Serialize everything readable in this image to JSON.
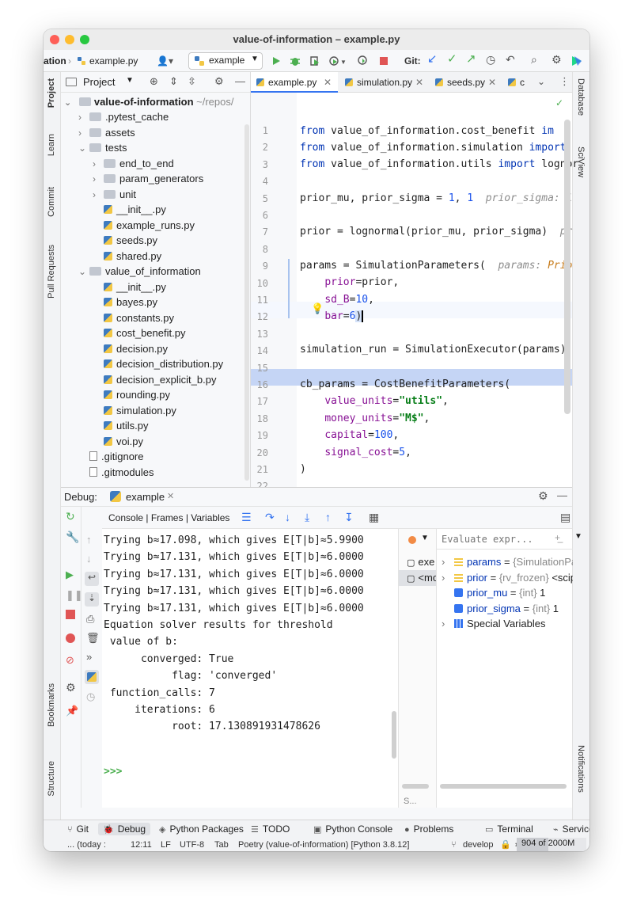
{
  "window": {
    "title": "value-of-information – example.py"
  },
  "toolbar": {
    "breadcrumb_project": "ation",
    "breadcrumb_file": "example.py",
    "run_config": "example",
    "git_label": "Git:"
  },
  "project_panel": {
    "title": "Project",
    "root": {
      "name": "value-of-information",
      "path": "~/repos/"
    },
    "items": [
      {
        "label": ".pytest_cache",
        "type": "folder",
        "arrow": "›"
      },
      {
        "label": "assets",
        "type": "folder",
        "arrow": "›"
      },
      {
        "label": "tests",
        "type": "folder",
        "arrow": "⌄"
      },
      {
        "label": "end_to_end",
        "type": "folder",
        "arrow": "›"
      },
      {
        "label": "param_generators",
        "type": "folder",
        "arrow": "›"
      },
      {
        "label": "unit",
        "type": "folder",
        "arrow": "›"
      },
      {
        "label": "__init__.py",
        "type": "py",
        "arrow": ""
      },
      {
        "label": "example_runs.py",
        "type": "py",
        "arrow": ""
      },
      {
        "label": "seeds.py",
        "type": "py",
        "arrow": ""
      },
      {
        "label": "shared.py",
        "type": "py",
        "arrow": ""
      },
      {
        "label": "value_of_information",
        "type": "folder",
        "arrow": "⌄"
      },
      {
        "label": "__init__.py",
        "type": "py",
        "arrow": ""
      },
      {
        "label": "bayes.py",
        "type": "py",
        "arrow": ""
      },
      {
        "label": "constants.py",
        "type": "py",
        "arrow": ""
      },
      {
        "label": "cost_benefit.py",
        "type": "py",
        "arrow": ""
      },
      {
        "label": "decision.py",
        "type": "py",
        "arrow": ""
      },
      {
        "label": "decision_distribution.py",
        "type": "py",
        "arrow": ""
      },
      {
        "label": "decision_explicit_b.py",
        "type": "py",
        "arrow": ""
      },
      {
        "label": "rounding.py",
        "type": "py",
        "arrow": ""
      },
      {
        "label": "simulation.py",
        "type": "py",
        "arrow": ""
      },
      {
        "label": "utils.py",
        "type": "py",
        "arrow": ""
      },
      {
        "label": "voi.py",
        "type": "py",
        "arrow": ""
      },
      {
        "label": ".gitignore",
        "type": "file",
        "arrow": ""
      },
      {
        "label": ".gitmodules",
        "type": "file",
        "arrow": ""
      }
    ]
  },
  "left_strip": {
    "project": "Project",
    "learn": "Learn",
    "commit": "Commit",
    "pull_requests": "Pull Requests",
    "bookmarks": "Bookmarks",
    "structure": "Structure"
  },
  "right_strip": {
    "database": "Database",
    "sciview": "SciView",
    "notifications": "Notifications"
  },
  "editor": {
    "tabs": [
      {
        "label": "example.py",
        "active": true
      },
      {
        "label": "simulation.py",
        "active": false
      },
      {
        "label": "seeds.py",
        "active": false
      },
      {
        "label": "c",
        "active": false
      }
    ],
    "line_numbers": [
      "1",
      "2",
      "3",
      "4",
      "5",
      "6",
      "7",
      "8",
      "9",
      "10",
      "11",
      "12",
      "13",
      "14",
      "15",
      "16",
      "17",
      "18",
      "19",
      "20",
      "21",
      "22"
    ],
    "lines": {
      "l1a": "from",
      "l1b": " value_of_information.cost_benefit ",
      "l1c": "im",
      "l2a": "from",
      "l2b": " value_of_information.simulation ",
      "l2c": "import",
      "l3a": "from",
      "l3b": " value_of_information.utils ",
      "l3c": "import",
      "l3d": " lognor",
      "l5a": "prior_mu, prior_sigma = ",
      "l5b": "1",
      "l5c": ", ",
      "l5d": "1",
      "l5hint": "  prior_sigma: 1",
      "l7a": "prior = lognormal(prior_mu, prior_sigma)",
      "l7hint": "  pr",
      "l9a": "params = SimulationParameters(",
      "l9hint": "  params: ",
      "l9hint2": "Prio",
      "l10a": "    ",
      "l10b": "prior",
      "l10c": "=prior,",
      "l11b": "sd_B",
      "l11c": "=",
      "l11d": "10",
      "l11e": ",",
      "l12b": "bar",
      "l12c": "=",
      "l12d": "6",
      "l12e": ")",
      "l14a": "simulation_run = SimulationExecutor(params).",
      "l16a": "cb_params = CostBenefitParameters(",
      "l17b": "value_units",
      "l17c": "=",
      "l17d": "\"utils\"",
      "l17e": ",",
      "l18b": "money_units",
      "l18c": "=",
      "l18d": "\"M$\"",
      "l18e": ",",
      "l19b": "capital",
      "l19c": "=",
      "l19d": "100",
      "l19e": ",",
      "l20b": "signal_cost",
      "l20c": "=",
      "l20d": "5",
      "l20e": ",",
      "l21a": ")"
    }
  },
  "debug": {
    "label": "Debug:",
    "config": "example",
    "sub_tabs": "Console | Frames | Variables",
    "console_lines": [
      "Trying b≈17.098, which gives E[T|b]≈5.9900",
      "Trying b≈17.131, which gives E[T|b]≈6.0000",
      "Trying b≈17.131, which gives E[T|b]≈6.0000",
      "Trying b≈17.131, which gives E[T|b]≈6.0000",
      "Trying b≈17.131, which gives E[T|b]≈6.0000",
      "Equation solver results for threshold",
      " value of b:",
      "      converged: True",
      "           flag: 'converged'",
      " function_calls: 7",
      "     iterations: 6",
      "           root: 17.130891931478626"
    ],
    "prompt": ">>>",
    "frames": [
      "exe",
      "<mo"
    ],
    "frames_bottom": "S...",
    "evaluate_placeholder": "Evaluate expr...",
    "variables": [
      {
        "name": "params",
        "eq": " = ",
        "type": "{SimulationPara",
        "value": "",
        "expand": "›"
      },
      {
        "name": "prior",
        "eq": " = ",
        "type": "{rv_frozen}",
        "value": " <scipy",
        "expand": "›"
      },
      {
        "name": "prior_mu",
        "eq": " = ",
        "type": "{int}",
        "value": " 1",
        "expand": ""
      },
      {
        "name": "prior_sigma",
        "eq": " = ",
        "type": "{int}",
        "value": " 1",
        "expand": ""
      },
      {
        "name": "Special Variables",
        "eq": "",
        "type": "",
        "value": "",
        "expand": "›"
      }
    ]
  },
  "bottom_tabs": [
    "Git",
    "Debug",
    "Python Packages",
    "TODO",
    "Python Console",
    "Problems",
    "Terminal",
    "Services"
  ],
  "status": {
    "left": "... (today :",
    "pos": "12:11",
    "lf": "LF",
    "enc": "UTF-8",
    "indent": "Tab",
    "interp": "Poetry (value-of-information) [Python 3.8.12]",
    "branch": "develop",
    "memory": "904 of 2000M",
    "memory_used_fraction": 0.45
  },
  "colors": {
    "accent": "#3574f0",
    "run_green": "#4caf50",
    "stop_red": "#e05555",
    "code_keyword": "#0033b3",
    "string_green": "#067d17",
    "param_purple": "#871094"
  }
}
